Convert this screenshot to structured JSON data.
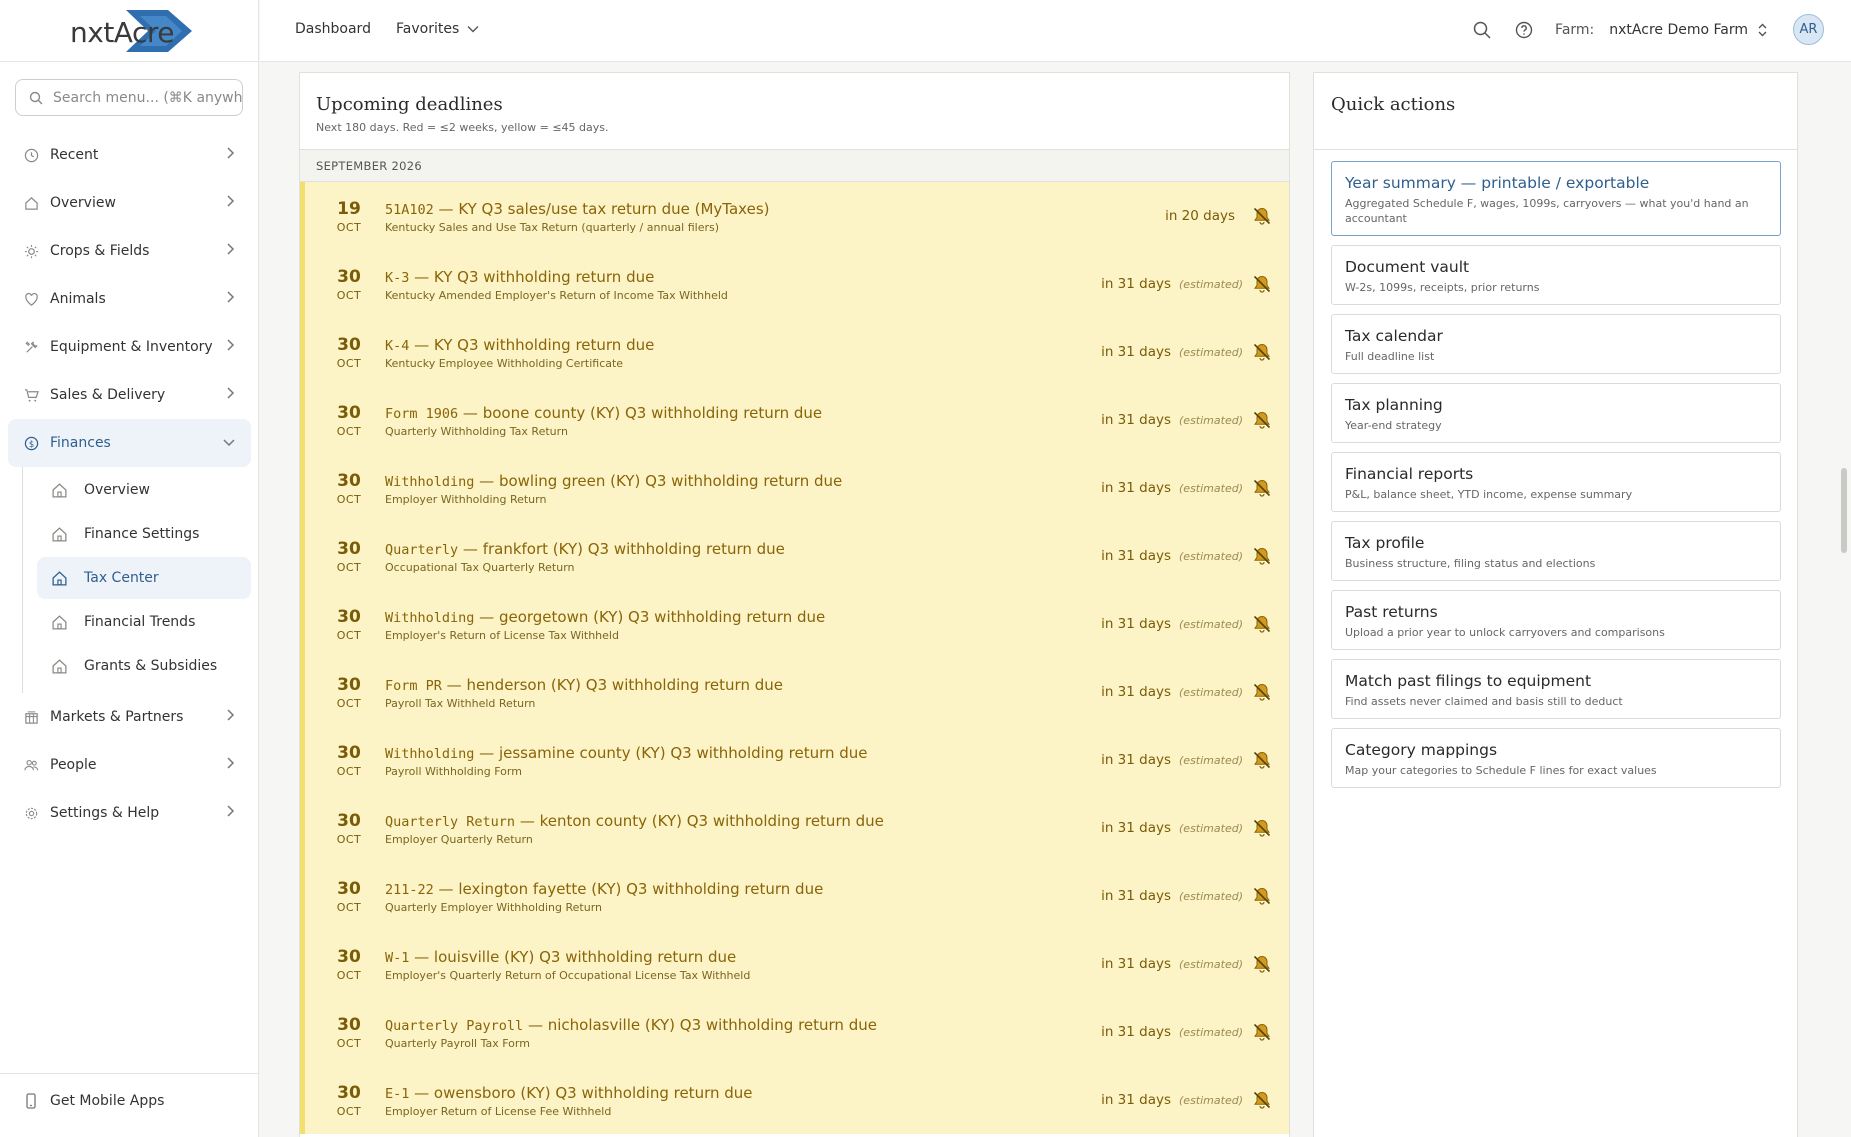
{
  "brand": {
    "logo_text": "nxtAcre",
    "accent": "#2f6fb0"
  },
  "search": {
    "placeholder": "Search menu...  (⌘K anywhe"
  },
  "nav": [
    {
      "label": "Recent",
      "icon": "clock-icon"
    },
    {
      "label": "Overview",
      "icon": "home-icon"
    },
    {
      "label": "Crops & Fields",
      "icon": "sun-icon"
    },
    {
      "label": "Animals",
      "icon": "heart-icon"
    },
    {
      "label": "Equipment & Inventory",
      "icon": "tools-icon"
    },
    {
      "label": "Sales & Delivery",
      "icon": "cart-icon"
    },
    {
      "label": "Finances",
      "icon": "dollar-icon",
      "expanded": true
    },
    {
      "label": "Markets & Partners",
      "icon": "building-icon"
    },
    {
      "label": "People",
      "icon": "people-icon"
    },
    {
      "label": "Settings & Help",
      "icon": "gear-icon"
    }
  ],
  "finances_sub": [
    {
      "label": "Overview"
    },
    {
      "label": "Finance Settings"
    },
    {
      "label": "Tax Center",
      "active": true
    },
    {
      "label": "Financial Trends"
    },
    {
      "label": "Grants & Subsidies"
    }
  ],
  "mobile": {
    "label": "Get Mobile Apps"
  },
  "topbar": {
    "dashboard": "Dashboard",
    "favorites": "Favorites",
    "farm_label": "Farm:",
    "farm_name": "nxtAcre Demo Farm",
    "avatar": "AR"
  },
  "deadlines": {
    "title": "Upcoming deadlines",
    "subtitle": "Next 180 days. Red = ≤2 weeks, yellow = ≤45 days.",
    "month": "SEPTEMBER 2026",
    "rows": [
      {
        "day": "19",
        "mon": "OCT",
        "code": "51A102",
        "title": " — KY Q3 sales/use tax return due (MyTaxes)",
        "desc": "Kentucky Sales and Use Tax Return (quarterly / annual filers)",
        "in": "in 20 days",
        "est": ""
      },
      {
        "day": "30",
        "mon": "OCT",
        "code": "K-3",
        "title": " — KY Q3 withholding return due",
        "desc": "Kentucky Amended Employer's Return of Income Tax Withheld",
        "in": "in 31 days",
        "est": "(estimated)"
      },
      {
        "day": "30",
        "mon": "OCT",
        "code": "K-4",
        "title": " — KY Q3 withholding return due",
        "desc": "Kentucky Employee Withholding Certificate",
        "in": "in 31 days",
        "est": "(estimated)"
      },
      {
        "day": "30",
        "mon": "OCT",
        "code": "Form 1906",
        "title": " — boone county (KY) Q3 withholding return due",
        "desc": "Quarterly Withholding Tax Return",
        "in": "in 31 days",
        "est": "(estimated)"
      },
      {
        "day": "30",
        "mon": "OCT",
        "code": "Withholding",
        "title": " — bowling green (KY) Q3 withholding return due",
        "desc": "Employer Withholding Return",
        "in": "in 31 days",
        "est": "(estimated)"
      },
      {
        "day": "30",
        "mon": "OCT",
        "code": "Quarterly",
        "title": " — frankfort (KY) Q3 withholding return due",
        "desc": "Occupational Tax Quarterly Return",
        "in": "in 31 days",
        "est": "(estimated)"
      },
      {
        "day": "30",
        "mon": "OCT",
        "code": "Withholding",
        "title": " — georgetown (KY) Q3 withholding return due",
        "desc": "Employer's Return of License Tax Withheld",
        "in": "in 31 days",
        "est": "(estimated)"
      },
      {
        "day": "30",
        "mon": "OCT",
        "code": "Form PR",
        "title": " — henderson (KY) Q3 withholding return due",
        "desc": "Payroll Tax Withheld Return",
        "in": "in 31 days",
        "est": "(estimated)"
      },
      {
        "day": "30",
        "mon": "OCT",
        "code": "Withholding",
        "title": " — jessamine county (KY) Q3 withholding return due",
        "desc": "Payroll Withholding Form",
        "in": "in 31 days",
        "est": "(estimated)"
      },
      {
        "day": "30",
        "mon": "OCT",
        "code": "Quarterly Return",
        "title": " — kenton county (KY) Q3 withholding return due",
        "desc": "Employer Quarterly Return",
        "in": "in 31 days",
        "est": "(estimated)"
      },
      {
        "day": "30",
        "mon": "OCT",
        "code": "211-22",
        "title": " — lexington fayette (KY) Q3 withholding return due",
        "desc": "Quarterly Employer Withholding Return",
        "in": "in 31 days",
        "est": "(estimated)"
      },
      {
        "day": "30",
        "mon": "OCT",
        "code": "W-1",
        "title": " — louisville (KY) Q3 withholding return due",
        "desc": "Employer's Quarterly Return of Occupational License Tax Withheld",
        "in": "in 31 days",
        "est": "(estimated)"
      },
      {
        "day": "30",
        "mon": "OCT",
        "code": "Quarterly Payroll",
        "title": " — nicholasville (KY) Q3 withholding return due",
        "desc": "Quarterly Payroll Tax Form",
        "in": "in 31 days",
        "est": "(estimated)"
      },
      {
        "day": "30",
        "mon": "OCT",
        "code": "E-1",
        "title": " — owensboro (KY) Q3 withholding return due",
        "desc": "Employer Return of License Fee Withheld",
        "in": "in 31 days",
        "est": "(estimated)"
      }
    ]
  },
  "quick_actions": {
    "title": "Quick actions",
    "items": [
      {
        "name": "Year summary — printable / exportable",
        "desc": "Aggregated Schedule F, wages, 1099s, carryovers — what you'd hand an accountant",
        "primary": true
      },
      {
        "name": "Document vault",
        "desc": "W-2s, 1099s, receipts, prior returns"
      },
      {
        "name": "Tax calendar",
        "desc": "Full deadline list"
      },
      {
        "name": "Tax planning",
        "desc": "Year-end strategy"
      },
      {
        "name": "Financial reports",
        "desc": "P&L, balance sheet, YTD income, expense summary"
      },
      {
        "name": "Tax profile",
        "desc": "Business structure, filing status and elections"
      },
      {
        "name": "Past returns",
        "desc": "Upload a prior year to unlock carryovers and comparisons"
      },
      {
        "name": "Match past filings to equipment",
        "desc": "Find assets never claimed and basis still to deduct"
      },
      {
        "name": "Category mappings",
        "desc": "Map your categories to Schedule F lines for exact values"
      }
    ]
  },
  "colors": {
    "deadline_bg": "#fcf4c6",
    "deadline_text": "#8a6408",
    "active_nav": "#2f5f8f"
  }
}
